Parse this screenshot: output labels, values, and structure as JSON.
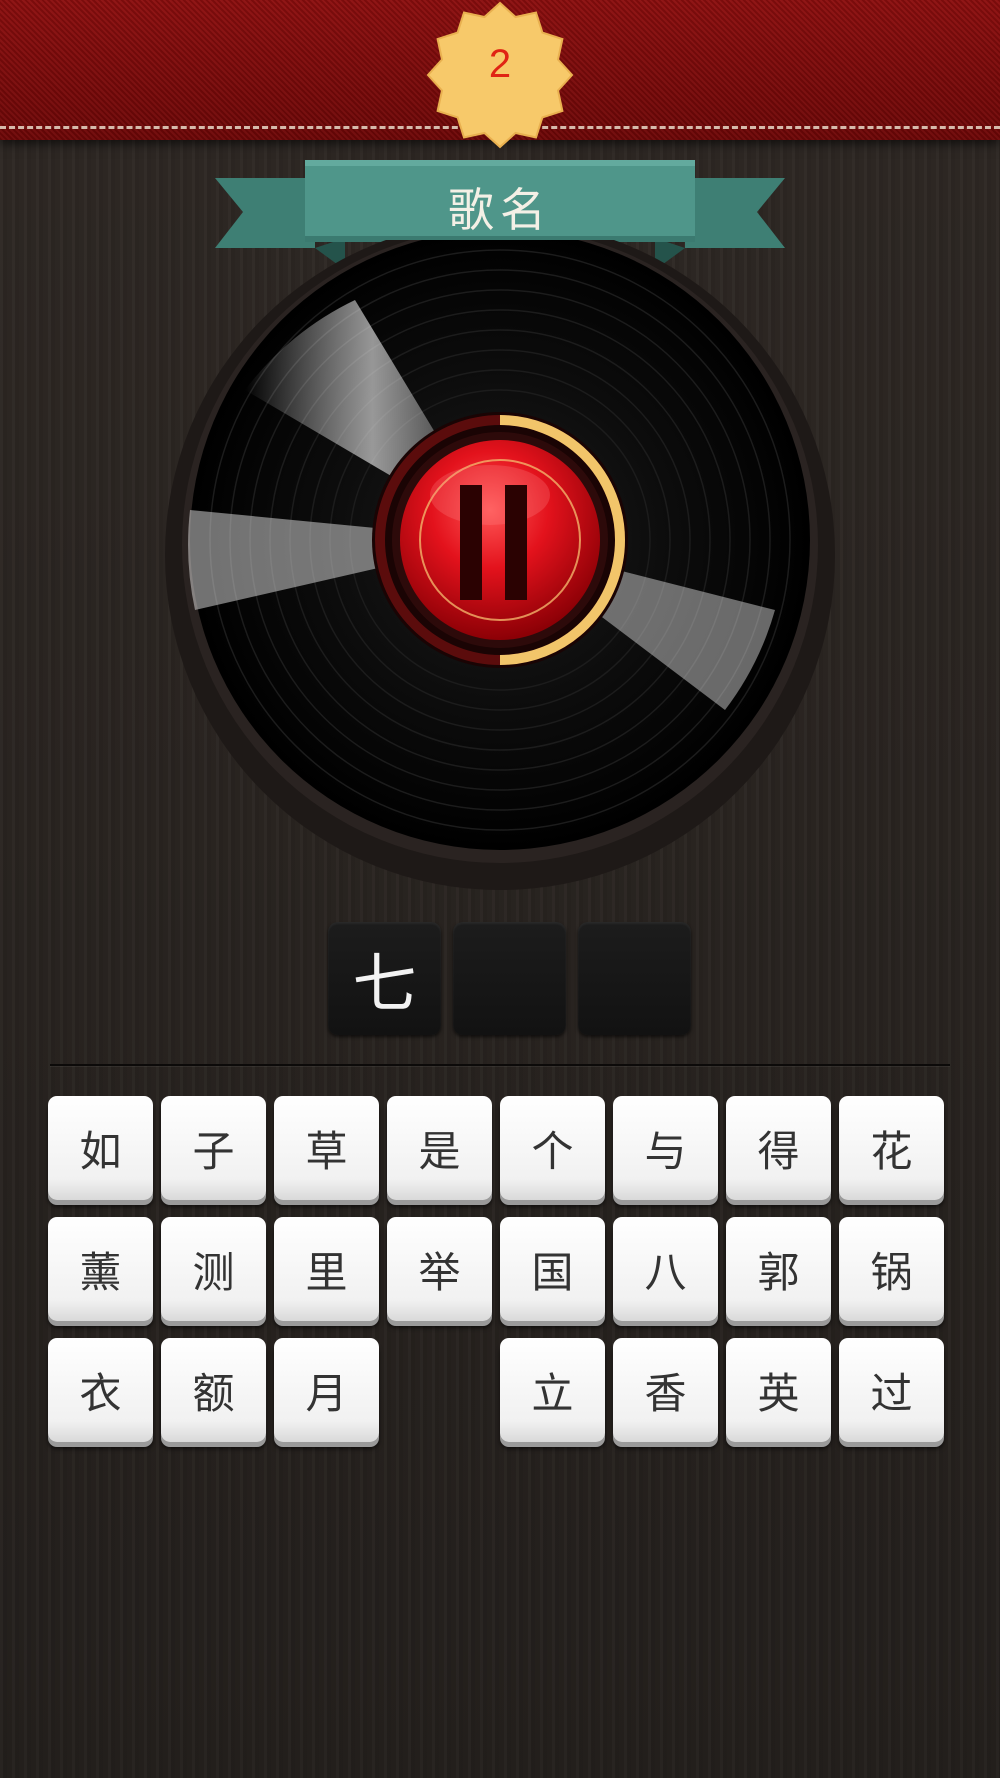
{
  "level": {
    "number": "2"
  },
  "category": {
    "label": "歌名"
  },
  "player": {
    "state": "playing",
    "progress": 0.5
  },
  "answer": {
    "slots": [
      "七",
      "",
      ""
    ]
  },
  "keyboard": {
    "rows": [
      [
        "如",
        "子",
        "草",
        "是",
        "个",
        "与",
        "得",
        "花"
      ],
      [
        "薰",
        "测",
        "里",
        "举",
        "国",
        "八",
        "郭",
        "锅"
      ],
      [
        "衣",
        "额",
        "月",
        "",
        "立",
        "香",
        "英",
        "过"
      ]
    ]
  },
  "colors": {
    "header_red": "#7a0a0a",
    "badge_yellow": "#f7c96a",
    "ribbon_teal": "#4f968a",
    "progress_gold": "#f2c56a",
    "button_red": "#d8141e"
  }
}
